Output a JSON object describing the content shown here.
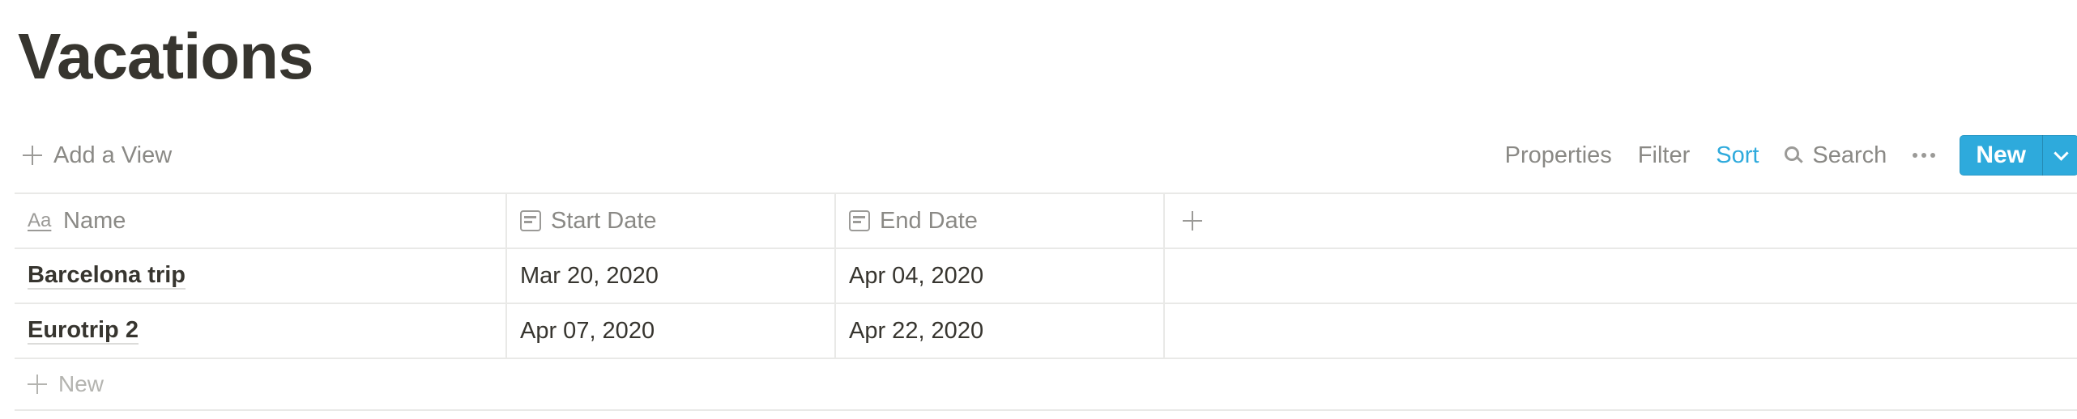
{
  "page": {
    "title": "Vacations"
  },
  "toolbar": {
    "add_view_label": "Add a View",
    "properties_label": "Properties",
    "filter_label": "Filter",
    "sort_label": "Sort",
    "search_label": "Search",
    "new_label": "New",
    "accent_color": "#2eaadc"
  },
  "table": {
    "columns": [
      {
        "label": "Name",
        "icon": "text-property-icon"
      },
      {
        "label": "Start Date",
        "icon": "calendar-icon"
      },
      {
        "label": "End Date",
        "icon": "calendar-icon"
      }
    ],
    "rows": [
      {
        "name": "Barcelona trip",
        "start_date": "Mar 20, 2020",
        "end_date": "Apr 04, 2020"
      },
      {
        "name": "Eurotrip 2",
        "start_date": "Apr 07, 2020",
        "end_date": "Apr 22, 2020"
      }
    ],
    "new_row_label": "New"
  }
}
